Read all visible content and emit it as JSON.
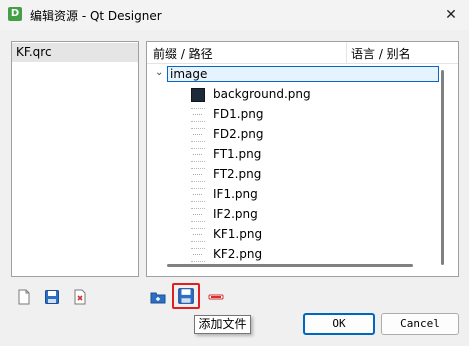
{
  "window": {
    "app_icon": "D",
    "title": "编辑资源 - Qt Designer",
    "close": "✕"
  },
  "files": [
    {
      "name": "KF.qrc"
    }
  ],
  "tree": {
    "columns": [
      "前缀 / 路径",
      "语言 / 别名"
    ],
    "folder": "image",
    "expand_arrow": "⌄",
    "items": [
      {
        "name": "background.png",
        "icon": "dark-image-icon"
      },
      {
        "name": "FD1.png",
        "icon": "image-icon"
      },
      {
        "name": "FD2.png",
        "icon": "image-icon"
      },
      {
        "name": "FT1.png",
        "icon": "image-icon"
      },
      {
        "name": "FT2.png",
        "icon": "image-icon"
      },
      {
        "name": "IF1.png",
        "icon": "image-icon"
      },
      {
        "name": "IF2.png",
        "icon": "image-icon"
      },
      {
        "name": "KF1.png",
        "icon": "image-icon"
      },
      {
        "name": "KF2.png",
        "icon": "image-icon"
      }
    ]
  },
  "toolbar": {
    "tooltip": "添加文件"
  },
  "buttons": {
    "ok": "OK",
    "cancel": "Cancel"
  }
}
